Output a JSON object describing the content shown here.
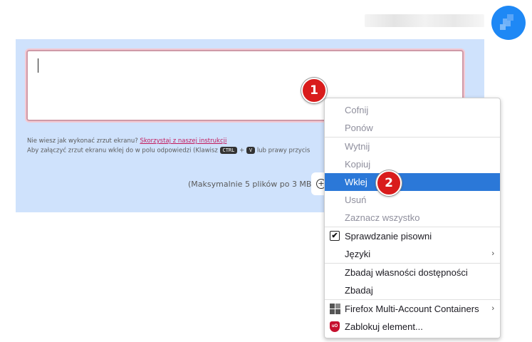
{
  "form": {
    "hint_line1_prefix": "Nie wiesz jak wykonać zrzut ekranu?",
    "hint_line1_link": "Skorzystaj z naszej instrukcji",
    "hint_line2_prefix": "Aby załączyć zrzut ekranu wklej do w polu odpowiedzi (Klawisz",
    "kbd_ctrl": "CTRL",
    "kbd_plus": "+",
    "kbd_v": "V",
    "hint_line2_suffix": "lub prawy przycis",
    "upload_limit": "(Maksymalnie 5 plików po 3 MB)",
    "add_symbol": "+"
  },
  "context_menu": {
    "items": [
      {
        "label": "Cofnij",
        "state": "disabled"
      },
      {
        "label": "Ponów",
        "state": "disabled"
      },
      {
        "label": "Wytnij",
        "state": "disabled"
      },
      {
        "label": "Kopiuj",
        "state": "disabled"
      },
      {
        "label": "Wklej",
        "state": "highlighted"
      },
      {
        "label": "Usuń",
        "state": "disabled"
      },
      {
        "label": "Zaznacz wszystko",
        "state": "disabled"
      },
      {
        "label": "Sprawdzanie pisowni",
        "state": "checked"
      },
      {
        "label": "Języki",
        "state": "submenu"
      },
      {
        "label": "Zbadaj własności dostępności",
        "state": "enabled"
      },
      {
        "label": "Zbadaj",
        "state": "enabled"
      },
      {
        "label": "Firefox Multi-Account Containers",
        "state": "submenu",
        "icon": "containers-icon"
      },
      {
        "label": "Zablokuj element...",
        "state": "enabled",
        "icon": "ublock-shield-icon"
      }
    ],
    "submenu_arrow": "›",
    "check_mark": "✔",
    "ublock_text": "uO"
  },
  "annotations": {
    "badge1": "1",
    "badge2": "2",
    "badge_color": "#d91c1c"
  },
  "colors": {
    "panel_bg": "#cfe2fc",
    "avatar": "#1e88f5",
    "menu_highlight": "#2b78d8",
    "link": "#c2185b"
  }
}
